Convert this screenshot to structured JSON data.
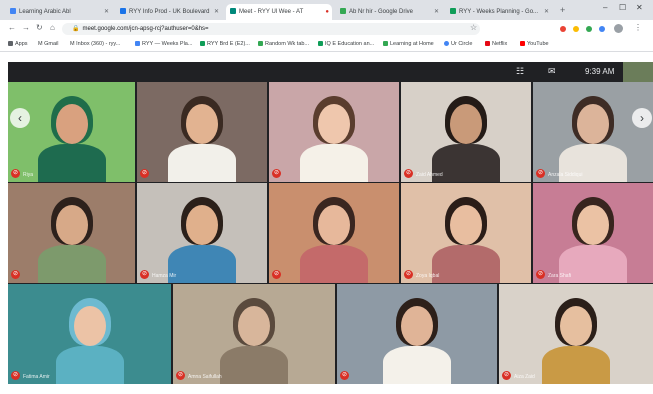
{
  "browser": {
    "tabs": [
      {
        "label": "Learning Arabic Abl",
        "color": "#4285f4",
        "active": false
      },
      {
        "label": "RYY Info Prod - UK Boulevard",
        "color": "#1a73e8",
        "active": false
      },
      {
        "label": "Meet - RYY Ul Wee - AT",
        "color": "#00897b",
        "active": true
      },
      {
        "label": "Ab Nr hir - Google Drive",
        "color": "#34a853",
        "active": false
      },
      {
        "label": "RYY - Weeks Planning - Go...",
        "color": "#0f9d58",
        "active": false
      }
    ],
    "new_tab": "+",
    "url": "meet.google.com/jcn-apsg-rcj?authuser=0&hs=",
    "bookmarks": [
      {
        "label": "Apps",
        "color": "#5f6368"
      },
      {
        "label": "M Gmail",
        "color": "#ea4335"
      },
      {
        "label": "M Inbox (360) - ryy...",
        "color": "#ea4335"
      },
      {
        "label": "RYY — Weeks Pla...",
        "color": "#4285f4"
      },
      {
        "label": "RYY Brd E (E2)...",
        "color": "#0f9d58"
      },
      {
        "label": "Random Wk tab...",
        "color": "#34a853"
      },
      {
        "label": "IQ E Education an...",
        "color": "#0f9d58"
      },
      {
        "label": "Learning at Home",
        "color": "#34a853"
      },
      {
        "label": "Ur Circle",
        "color": "#4285f4"
      },
      {
        "label": "Netflix",
        "color": "#e50914"
      },
      {
        "label": "YouTube",
        "color": "#ff0000"
      }
    ]
  },
  "meet": {
    "time": "9:39 AM"
  },
  "participants": [
    {
      "name": "Riya",
      "bg": "#7fbf6a",
      "skin": "#d9a17f",
      "shirt": "#1e6b4f",
      "hair": "#1f6d4a"
    },
    {
      "name": "",
      "bg": "#7c6a63",
      "skin": "#e2b391",
      "shirt": "#f2f0ea",
      "hair": "#3a2a22"
    },
    {
      "name": "",
      "bg": "#c9a6a8",
      "skin": "#efc7ad",
      "shirt": "#f5f1e8",
      "hair": "#5a3d2e"
    },
    {
      "name": "Zaid Ahmed",
      "bg": "#d7d0c8",
      "skin": "#c99a79",
      "shirt": "#3b3433",
      "hair": "#241b17"
    },
    {
      "name": "Anzala Siddiqui",
      "bg": "#9aa0a4",
      "skin": "#dcb49a",
      "shirt": "#e8e3dc",
      "hair": "#3e2c25"
    },
    {
      "name": "",
      "bg": "#9c7d6a",
      "skin": "#d7a988",
      "shirt": "#7d9a6c",
      "hair": "#2d211c"
    },
    {
      "name": "Hamza Mir",
      "bg": "#c5c0ba",
      "skin": "#e0b08c",
      "shirt": "#3f86b5",
      "hair": "#2b201a"
    },
    {
      "name": "",
      "bg": "#c98f6e",
      "skin": "#e7b89b",
      "shirt": "#c46a6a",
      "hair": "#3a2620"
    },
    {
      "name": "Zoya Iqbal",
      "bg": "#e0c0a8",
      "skin": "#e8bea0",
      "shirt": "#b36b6b",
      "hair": "#2a1d18"
    },
    {
      "name": "Zara Shafi",
      "bg": "#c77d95",
      "skin": "#ebc2a4",
      "shirt": "#e7a9bd",
      "hair": "#38251f"
    },
    {
      "name": "Fatima Amir",
      "bg": "#3c8c8f",
      "skin": "#ecc3a6",
      "shirt": "#5bb1c2",
      "hair": "#6dbad0"
    },
    {
      "name": "Amna Saifullah",
      "bg": "#b7a994",
      "skin": "#d8b69b",
      "shirt": "#8b7b68",
      "hair": "#5a4a3d"
    },
    {
      "name": "",
      "bg": "#8e9aa5",
      "skin": "#e0b497",
      "shirt": "#f4f1ea",
      "hair": "#2d201a"
    },
    {
      "name": "Aiza Zaid",
      "bg": "#d9d2c9",
      "skin": "#e6bf9f",
      "shirt": "#c99a45",
      "hair": "#2b1f19"
    }
  ]
}
